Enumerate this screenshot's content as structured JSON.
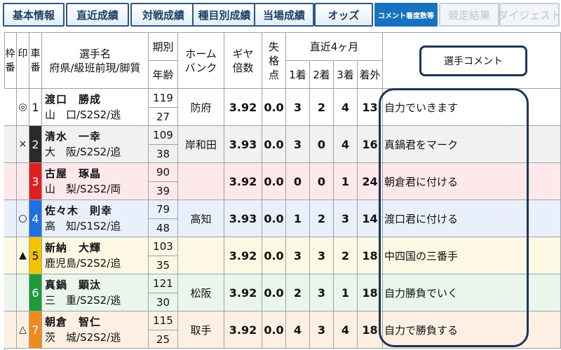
{
  "tabs": [
    {
      "label": "基本情報",
      "state": "normal"
    },
    {
      "label": "直近成績",
      "state": "normal"
    },
    {
      "label": "対戦成績",
      "state": "normal"
    },
    {
      "label": "種目別成績",
      "state": "normal"
    },
    {
      "label": "当場成績",
      "state": "normal"
    },
    {
      "label": "オッズ",
      "state": "normal"
    },
    {
      "label": "コメント着度数等",
      "state": "active"
    },
    {
      "label": "競走結果",
      "state": "disabled"
    },
    {
      "label": "ダイジェスト",
      "state": "disabled"
    }
  ],
  "headers": {
    "waku": "枠番",
    "mark": "印",
    "car": "車番",
    "name": "選手名",
    "name_sub": "府県/級班前現/脚質",
    "term": "期別",
    "age": "年齢",
    "home": "ホームバンク",
    "gear": "ギヤ倍数",
    "dq": "失格点",
    "recent": "直近4ヶ月",
    "first": "1着",
    "second": "2着",
    "third": "3着",
    "other": "着外",
    "comment_button": "選手コメント"
  },
  "colors": {
    "tab_border": "#2a5788",
    "tab_active": "#1773c0",
    "highlight": "#1d3557"
  },
  "riders": [
    {
      "mark": "◎",
      "car": "1",
      "car_bg": "#ffffff",
      "car_fg": "#111111",
      "row_bg": "#ffffff",
      "name": "渡口　勝成",
      "region": "山　口/S2S2/逃",
      "term": "119",
      "age": "27",
      "home": "防府",
      "gear": "3.92",
      "dq": "0.0",
      "first": "3",
      "second": "2",
      "third": "4",
      "other": "13",
      "comment": "自力でいきます"
    },
    {
      "mark": "×",
      "car": "2",
      "car_bg": "#2a2a2a",
      "car_fg": "#ffffff",
      "row_bg": "#f1f1f1",
      "name": "清水　一幸",
      "region": "大　阪/S2S2/追",
      "term": "109",
      "age": "38",
      "home": "岸和田",
      "gear": "3.93",
      "dq": "0.0",
      "first": "3",
      "second": "0",
      "third": "4",
      "other": "16",
      "comment": "真鍋君をマーク"
    },
    {
      "mark": "",
      "car": "3",
      "car_bg": "#e02020",
      "car_fg": "#ffffff",
      "row_bg": "#fde9e9",
      "name": "古屋　琢晶",
      "region": "山　梨/S2S2/両",
      "term": "90",
      "age": "39",
      "home": "",
      "gear": "3.92",
      "dq": "0.0",
      "first": "0",
      "second": "0",
      "third": "1",
      "other": "24",
      "comment": "朝倉君に付ける"
    },
    {
      "mark": "○",
      "car": "4",
      "car_bg": "#1f6fe0",
      "car_fg": "#ffffff",
      "row_bg": "#e9f0fc",
      "name": "佐々木　則幸",
      "region": "高　知/S1S2/追",
      "term": "79",
      "age": "48",
      "home": "高知",
      "gear": "3.93",
      "dq": "0.0",
      "first": "1",
      "second": "2",
      "third": "3",
      "other": "14",
      "comment": "渡口君に付ける"
    },
    {
      "mark": "▲",
      "car": "5",
      "car_bg": "#f2c400",
      "car_fg": "#111111",
      "row_bg": "#fdf8e3",
      "name": "新納　大輝",
      "region": "鹿児島/S2S2/追",
      "term": "103",
      "age": "35",
      "home": "",
      "gear": "3.92",
      "dq": "0.0",
      "first": "3",
      "second": "3",
      "third": "2",
      "other": "18",
      "comment": "中四国の三番手"
    },
    {
      "mark": "",
      "car": "6",
      "car_bg": "#1f9a3c",
      "car_fg": "#ffffff",
      "row_bg": "#eaf6ec",
      "name": "真鍋　顕汰",
      "region": "三　重/S2S2/逃",
      "term": "121",
      "age": "30",
      "home": "松阪",
      "gear": "3.92",
      "dq": "0.0",
      "first": "2",
      "second": "3",
      "third": "1",
      "other": "18",
      "comment": "自力勝負でいく"
    },
    {
      "mark": "△",
      "car": "7",
      "car_bg": "#f08a1c",
      "car_fg": "#ffffff",
      "row_bg": "#fdf0e3",
      "name": "朝倉　智仁",
      "region": "茨　城/S2S2/逃",
      "term": "115",
      "age": "25",
      "home": "取手",
      "gear": "3.92",
      "dq": "0.0",
      "first": "4",
      "second": "3",
      "third": "4",
      "other": "18",
      "comment": "自力で勝負する"
    }
  ]
}
